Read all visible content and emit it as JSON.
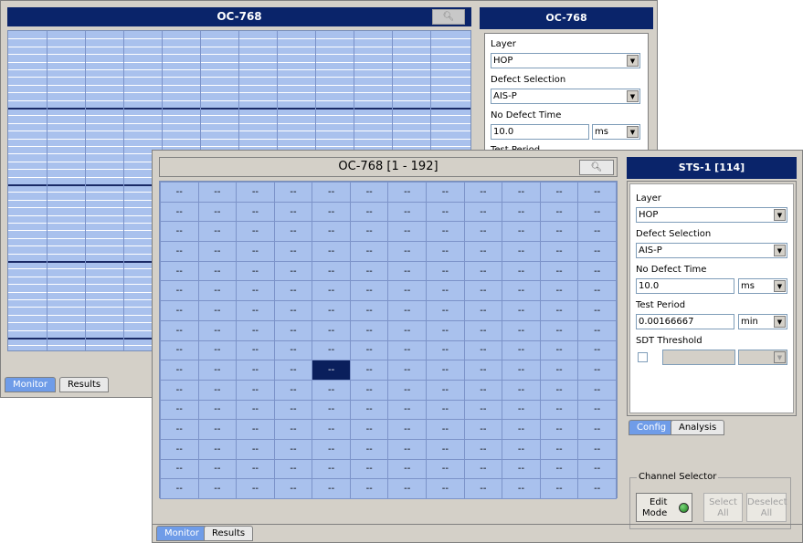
{
  "back": {
    "title": "OC-768",
    "zoom_icon": "magnifier-icon",
    "panel_title": "OC-768",
    "layer_label": "Layer",
    "layer_value": "HOP",
    "defect_label": "Defect Selection",
    "defect_value": "AIS-P",
    "no_defect_label": "No Defect Time",
    "no_defect_value": "10.0",
    "no_defect_unit": "ms",
    "test_period_label": "Test Period",
    "tabs": [
      "Monitor",
      "Results"
    ]
  },
  "front": {
    "grid_title": "OC-768 [1 - 192]",
    "zoom_icon": "magnifier-icon",
    "cell_text": "--",
    "columns": 12,
    "rows": 16,
    "selected_cell": {
      "row": 10,
      "col": 5
    },
    "panel_title": "STS-1 [114]",
    "layer_label": "Layer",
    "layer_value": "HOP",
    "defect_label": "Defect Selection",
    "defect_value": "AIS-P",
    "no_defect_label": "No Defect Time",
    "no_defect_value": "10.0",
    "no_defect_unit": "ms",
    "test_period_label": "Test Period",
    "test_period_value": "0.00166667",
    "test_period_unit": "min",
    "sdt_label": "SDT Threshold",
    "panel_tabs": [
      "Config",
      "Analysis"
    ],
    "channel_selector_label": "Channel Selector",
    "edit_mode_line1": "Edit",
    "edit_mode_line2": "Mode",
    "select_all_line1": "Select",
    "select_all_line2": "All",
    "deselect_all_line1": "Deselect",
    "deselect_all_line2": "All",
    "bottom_tabs": [
      "Monitor",
      "Results"
    ]
  },
  "colors": {
    "title_bar": "#0a246a",
    "grid_cell": "#a9c1ed",
    "selected_cell": "#0a1f5c",
    "active_tab": "#6f9ce8",
    "led": "#2a9a2a"
  }
}
